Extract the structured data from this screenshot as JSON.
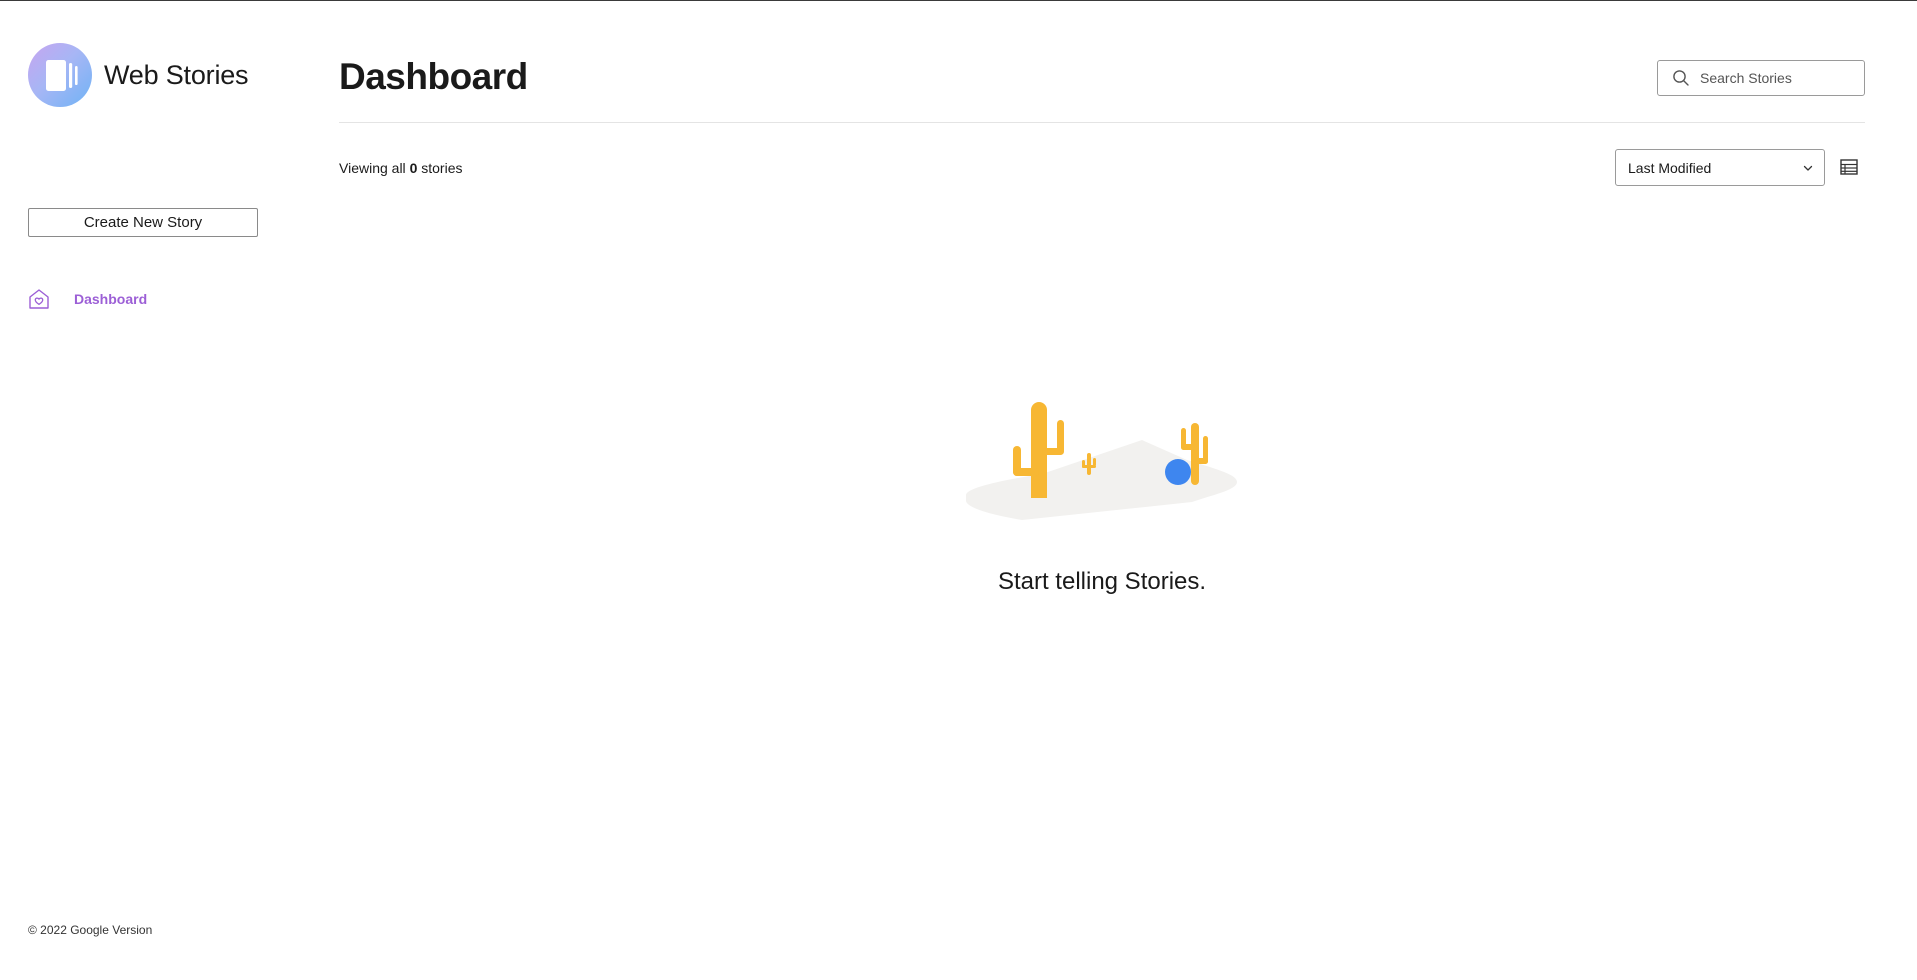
{
  "app": {
    "name": "Web Stories",
    "brand_color": "#9c5fd6"
  },
  "sidebar": {
    "create_button_label": "Create New Story",
    "nav_items": [
      {
        "label": "Dashboard",
        "icon": "home-icon",
        "active": true
      }
    ],
    "footer": "© 2022 Google Version"
  },
  "header": {
    "title": "Dashboard",
    "search": {
      "placeholder": "Search Stories",
      "value": ""
    }
  },
  "toolbar": {
    "viewing_prefix": "Viewing all",
    "story_count": "0",
    "viewing_suffix": "stories",
    "sort": {
      "selected": "Last Modified"
    },
    "view_toggle_icon": "list-view-icon"
  },
  "empty_state": {
    "message": "Start telling Stories.",
    "illustration": "desert-cactus-illustration"
  }
}
